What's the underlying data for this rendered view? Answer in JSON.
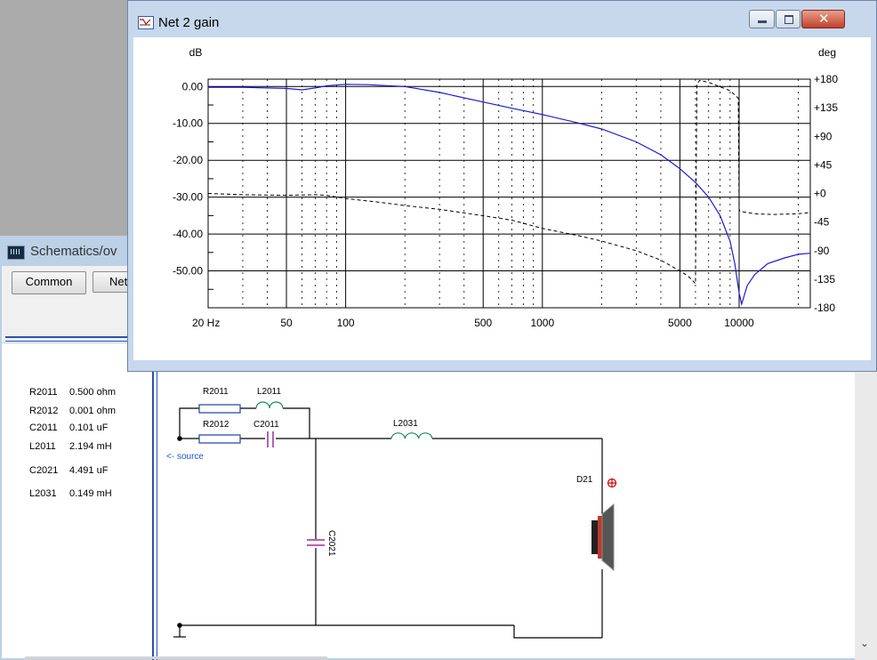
{
  "schematic_window": {
    "title": "Schematics/ov",
    "buttons": [
      "Common",
      "Net"
    ],
    "parts": [
      {
        "name": "R2011",
        "value": "0.500 ohm"
      },
      {
        "name": "R2012",
        "value": "0.001 ohm"
      },
      {
        "name": "C2011",
        "value": "0.101 uF"
      },
      {
        "name": "L2011",
        "value": "2.194 mH"
      },
      {
        "name": "C2021",
        "value": "4.491 uF"
      },
      {
        "name": "L2031",
        "value": "0.149 mH"
      }
    ],
    "circuit_labels": {
      "r2011": "R2011",
      "l2011": "L2011",
      "r2012": "R2012",
      "c2011": "C2011",
      "l2031": "L2031",
      "c2021": "C2021",
      "d21": "D21",
      "source": "<- source"
    },
    "colors": {
      "wire": "#000000",
      "resistor": "#1f3f9f",
      "inductor": "#1b8a5a",
      "capacitor": "#9b2a9b",
      "source": "#2450d8",
      "probe": "#cc0000"
    }
  },
  "gain_window": {
    "title": "Net 2 gain"
  },
  "chart_data": {
    "type": "line",
    "left_unit": "dB",
    "right_unit": "deg",
    "x_scale": "log",
    "xlim": [
      20,
      23000
    ],
    "x_tick_labels": [
      "20 Hz",
      "50",
      "100",
      "500",
      "1000",
      "5000",
      "10000"
    ],
    "x_tick_values": [
      20,
      50,
      100,
      500,
      1000,
      5000,
      10000
    ],
    "ylim_left": [
      -60,
      2
    ],
    "y_left_ticks": [
      "0.00",
      "-10.00",
      "-20.00",
      "-30.00",
      "-40.00",
      "-50.00"
    ],
    "y_left_tick_values": [
      0,
      -10,
      -20,
      -30,
      -40,
      -50
    ],
    "ylim_right": [
      -180,
      180
    ],
    "y_right_ticks": [
      "+180",
      "+135",
      "+90",
      "+45",
      "+0",
      "-45",
      "-90",
      "-135",
      "-180"
    ],
    "y_right_tick_values": [
      180,
      135,
      90,
      45,
      0,
      -45,
      -90,
      -135,
      -180
    ],
    "grid": true,
    "series": [
      {
        "axis": "left",
        "color": "#1a1ad6",
        "style": "solid",
        "x": [
          20,
          30,
          40,
          50,
          60,
          70,
          80,
          100,
          130,
          200,
          300,
          500,
          700,
          1000,
          1500,
          2000,
          3000,
          4000,
          5000,
          6000,
          7000,
          8000,
          9000,
          9500,
          10000,
          10300,
          11000,
          12000,
          14000,
          17000,
          20000,
          23000
        ],
        "y": [
          -0.2,
          -0.2,
          -0.4,
          -0.5,
          -0.9,
          -0.4,
          0.2,
          0.6,
          0.5,
          0.0,
          -1.6,
          -4.2,
          -5.9,
          -7.6,
          -9.8,
          -11.5,
          -15.0,
          -18.5,
          -22.3,
          -26.0,
          -30.0,
          -35.0,
          -42.0,
          -48.0,
          -56.0,
          -59.0,
          -54.0,
          -51.0,
          -48.0,
          -46.5,
          -45.5,
          -45.2
        ]
      },
      {
        "axis": "right",
        "color": "#000000",
        "style": "dashed",
        "x": [
          20,
          30,
          50,
          70,
          80,
          100,
          150,
          200,
          300,
          500,
          700,
          1000,
          1500,
          2000,
          3000,
          4000,
          5000,
          5500,
          6000,
          6100,
          6300,
          7000,
          8000,
          9000,
          9900,
          10000,
          10100,
          12000,
          15000,
          20000,
          23000
        ],
        "y": [
          0,
          -2,
          -3,
          -2,
          -3,
          -8,
          -14,
          -19,
          -25,
          -35,
          -42,
          -55,
          -66,
          -75,
          -90,
          -105,
          -122,
          -130,
          -142,
          172,
          178,
          175,
          168,
          162,
          150,
          -25,
          -28,
          -32,
          -33,
          -32,
          -30
        ]
      }
    ]
  }
}
